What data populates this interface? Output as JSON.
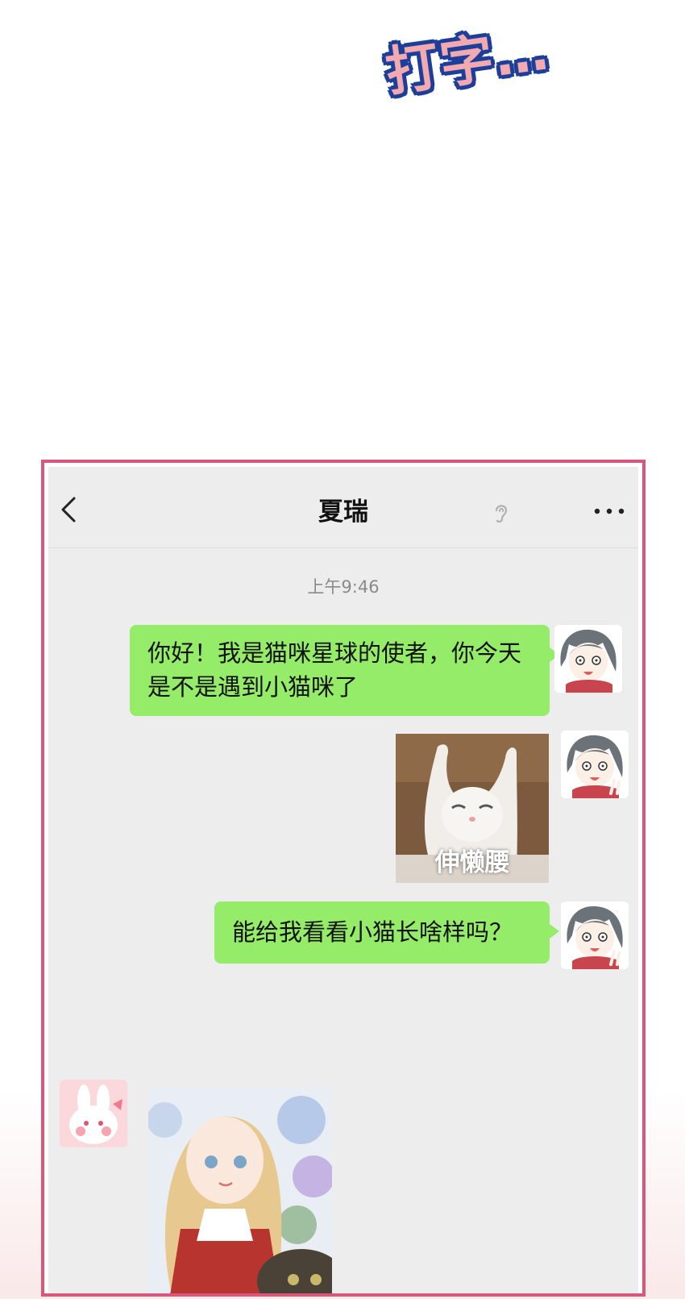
{
  "caption": {
    "text": "打字…"
  },
  "chat": {
    "contact_name": "夏瑞",
    "timestamp": "上午9:46",
    "messages": [
      {
        "type": "text",
        "from": "me",
        "text": "你好！我是猫咪星球的使者，你今天是不是遇到小猫咪了"
      },
      {
        "type": "sticker",
        "from": "me",
        "caption": "伸懒腰"
      },
      {
        "type": "text",
        "from": "me",
        "text": "能给我看看小猫长啥样吗？"
      },
      {
        "type": "image",
        "from": "contact"
      }
    ]
  },
  "icons": {
    "back": "chevron-left-icon",
    "voice": "ear-icon",
    "more": "more-dots-icon"
  },
  "colors": {
    "frame_border": "#d9577b",
    "chat_background": "#ededed",
    "bubble_green": "#95ec69"
  }
}
